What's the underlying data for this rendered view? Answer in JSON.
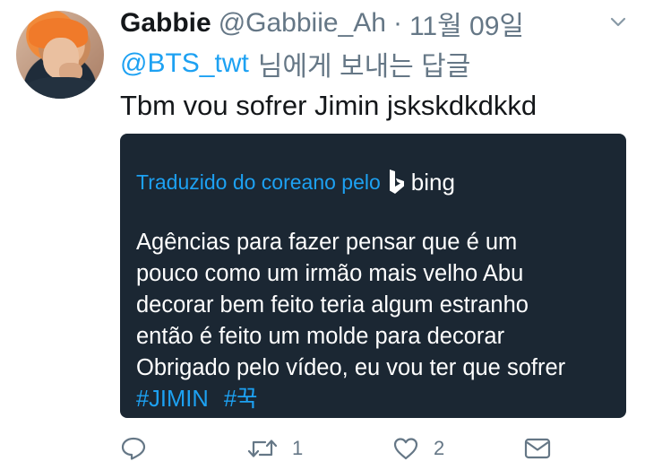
{
  "tweet": {
    "display_name": "Gabbie",
    "handle": "@Gabbiie_Ah",
    "separator": "·",
    "date": "11월 09일",
    "reply_to": {
      "mention": "@BTS_twt",
      "suffix": "님에게 보내는 답글"
    },
    "text": "Tbm vou sofrer Jimin jskskdkdkkd"
  },
  "translation": {
    "translated_by": "Traduzido do coreano pelo",
    "provider": "bing",
    "lines": [
      "Agências para fazer pensar que é um",
      "pouco como um irmão mais velho Abu",
      "decorar bem feito teria algum estranho",
      "então é feito um molde para decorar",
      "Obrigado pelo vídeo, eu vou ter que sofrer"
    ],
    "hashtags": [
      "#JIMIN",
      "#꾹"
    ]
  },
  "actions": {
    "reply_count": "",
    "retweet_count": "1",
    "like_count": "2"
  },
  "icons": {
    "menu": "chevron-down-icon",
    "reply": "speech-bubble-icon",
    "retweet": "retweet-arrows-icon",
    "like": "heart-icon",
    "dm": "envelope-icon",
    "bing": "bing-logo-icon"
  },
  "colors": {
    "accent": "#1da1f2",
    "text": "#14171a",
    "secondary": "#657786",
    "card_bg": "#1b2733",
    "card_text": "#ffffff"
  }
}
